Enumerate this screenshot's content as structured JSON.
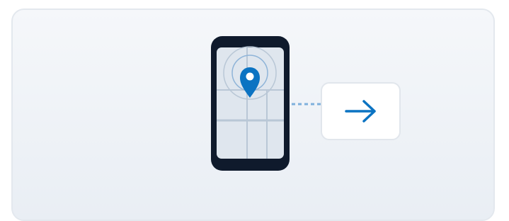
{
  "illustration": {
    "phone_icon": "smartphone-map-icon",
    "pin_icon": "location-pin-icon",
    "connector_icon": "dotted-connector",
    "arrow_icon": "arrow-right-icon"
  },
  "colors": {
    "card_bg_top": "#f5f7fa",
    "card_bg_bottom": "#e9eef4",
    "phone_body": "#0f1a2c",
    "map_bg": "#dfe6ee",
    "map_streets": "#b9c7d6",
    "accent_blue": "#0b73c2",
    "connector": "#7fb1dc"
  }
}
